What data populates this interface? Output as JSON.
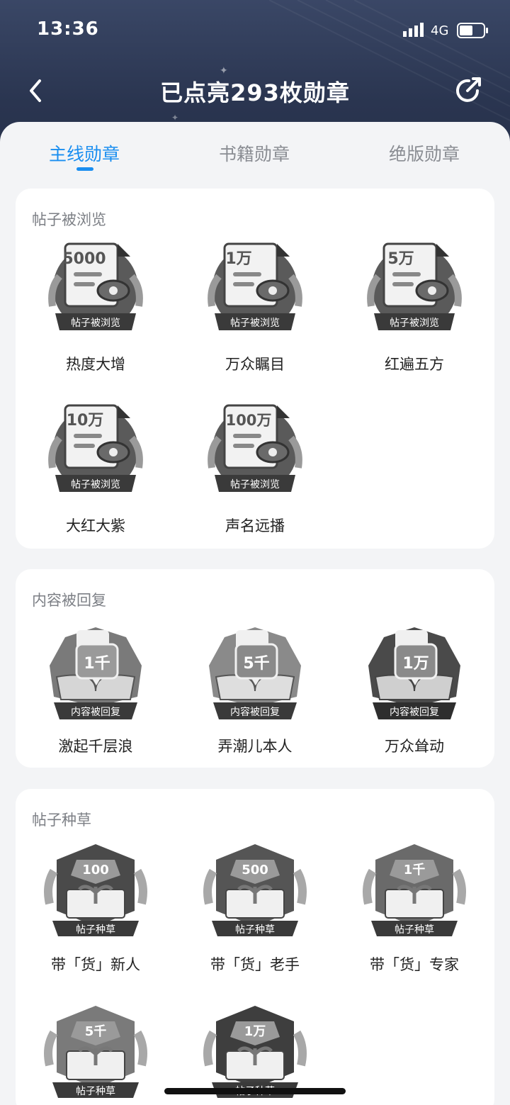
{
  "status_bar": {
    "time": "13:36",
    "network": "4G"
  },
  "header": {
    "title": "已点亮293枚勋章"
  },
  "tabs": [
    "主线勋章",
    "书籍勋章",
    "绝版勋章"
  ],
  "sections": [
    {
      "title": "帖子被浏览",
      "badges": [
        {
          "number": "5000",
          "ribbon": "帖子被浏览",
          "name": "热度大增"
        },
        {
          "number": "1万",
          "ribbon": "帖子被浏览",
          "name": "万众瞩目"
        },
        {
          "number": "5万",
          "ribbon": "帖子被浏览",
          "name": "红遍五方"
        },
        {
          "number": "10万",
          "ribbon": "帖子被浏览",
          "name": "大红大紫"
        },
        {
          "number": "100万",
          "ribbon": "帖子被浏览",
          "name": "声名远播"
        }
      ]
    },
    {
      "title": "内容被回复",
      "badges": [
        {
          "number": "1千",
          "ribbon": "内容被回复",
          "name": "激起千层浪"
        },
        {
          "number": "5千",
          "ribbon": "内容被回复",
          "name": "弄潮儿本人"
        },
        {
          "number": "1万",
          "ribbon": "内容被回复",
          "name": "万众耸动"
        }
      ]
    },
    {
      "title": "帖子种草",
      "badges": [
        {
          "number": "100",
          "ribbon": "帖子种草",
          "name": "带「货」新人"
        },
        {
          "number": "500",
          "ribbon": "帖子种草",
          "name": "带「货」老手"
        },
        {
          "number": "1千",
          "ribbon": "帖子种草",
          "name": "带「货」专家"
        },
        {
          "number": "5千",
          "ribbon": "帖子种草",
          "name": ""
        },
        {
          "number": "1万",
          "ribbon": "帖子种草",
          "name": ""
        }
      ]
    }
  ],
  "colors": {
    "accent": "#1a8ef0",
    "header_bg": "#2f3b58",
    "badge_grey": "#6f6f6f"
  }
}
